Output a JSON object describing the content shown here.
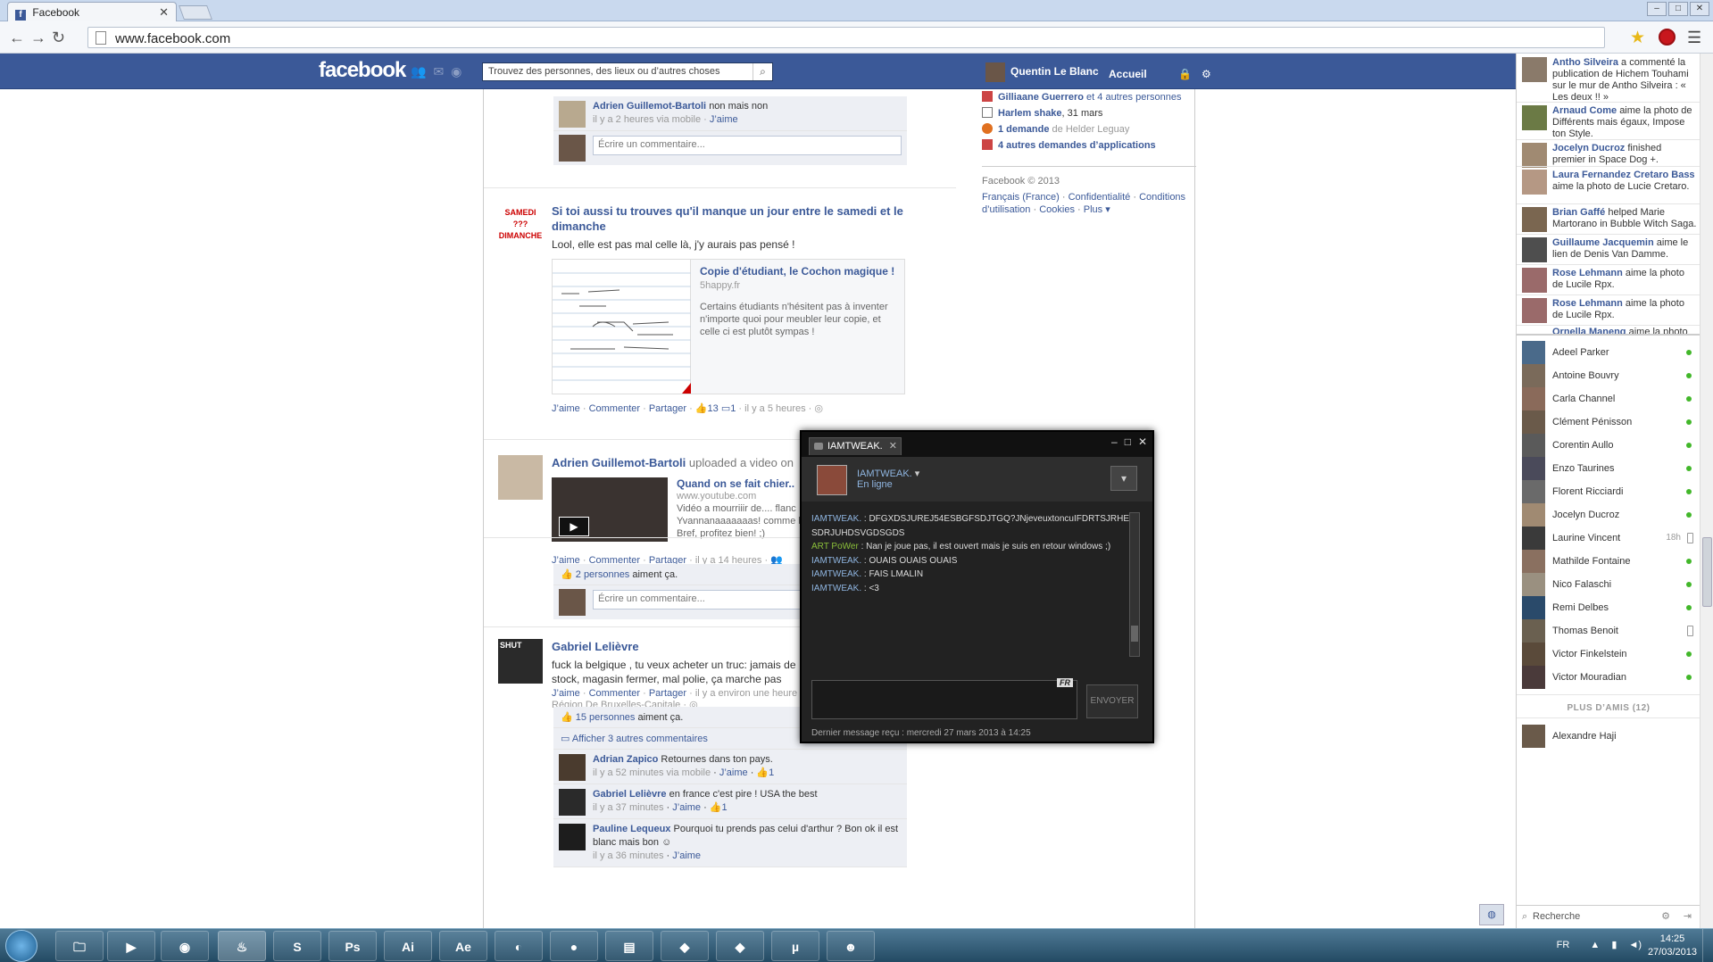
{
  "browser": {
    "tab_title": "Facebook",
    "url": "www.facebook.com"
  },
  "fb": {
    "logo": "facebook",
    "search_placeholder": "Trouvez des personnes, des lieux ou d’autres choses",
    "user_name": "Quentin Le Blanc",
    "home": "Accueil"
  },
  "feed": {
    "top_comment": {
      "author": "Adrien Guillemot-Bartoli",
      "text": "non mais non",
      "meta": "il y a 2 heures via mobile",
      "like": "J’aime"
    },
    "write_comment_placeholder": "Écrire un commentaire...",
    "post1": {
      "avatar_text": "SAMEDI ??? DIMANCHE",
      "title": "Si toi aussi tu trouves qu'il manque un jour entre le samedi et le dimanche",
      "message": "Lool, elle est pas mal celle là, j'y aurais pas pensé !",
      "link_title": "Copie d'étudiant, le Cochon magique !",
      "link_domain": "5happy.fr",
      "link_desc": "Certains étudiants n'hésitent pas à inventer n'importe quoi pour meubler leur copie, et celle ci est plutôt sympas !",
      "actions": {
        "like": "J’aime",
        "comment": "Commenter",
        "share": "Partager",
        "likes": "13",
        "comments": "1",
        "time": "il y a 5 heures"
      }
    },
    "post2": {
      "author": "Adrien Guillemot-Bartoli",
      "verb": "uploaded a video on",
      "link_title": "Quand on se fait chier..",
      "link_domain": "www.youtube.com",
      "link_desc": "Vidéo a mourriiir de.... flanc Yvannanaaaaaaas! comme le Bref, profitez bien! ;)",
      "actions": {
        "like": "J’aime",
        "comment": "Commenter",
        "share": "Partager",
        "time": "il y a 14 heures"
      },
      "likes_link": "2 personnes",
      "likes_suffix": "aiment ça."
    },
    "post3": {
      "author": "Gabriel Lelièvre",
      "avatar_text": "SHUT",
      "message": "fuck la belgique , tu veux acheter un truc: jamais de stock, magasin fermer, mal polie, ça marche pas",
      "actions": {
        "like": "J’aime",
        "comment": "Commenter",
        "share": "Partager",
        "time": "il y a environ une heure"
      },
      "location": "Région De Bruxelles-Capitale",
      "likes_link": "15 personnes",
      "likes_suffix": "aiment ça.",
      "show_comments": "Afficher 3 autres commentaires",
      "comments": [
        {
          "author": "Adrian Zapico",
          "text": "Retournes dans ton pays.",
          "meta": "il y a 52 minutes via mobile",
          "like": "J’aime",
          "count": "1"
        },
        {
          "author": "Gabriel Lelièvre",
          "text": "en france c'est pire ! USA the best",
          "meta": "il y a 37 minutes",
          "like": "J’aime",
          "count": "1"
        },
        {
          "author": "Pauline Lequeux",
          "text": "Pourquoi tu prends pas celui d'arthur ? Bon ok il est blanc mais bon",
          "meta": "il y a 36 minutes",
          "like": "J’aime",
          "count": ""
        }
      ]
    }
  },
  "right_col": {
    "birthday1_name": "Gilliaane Guerrero",
    "birthday1_rest": "et 4 autres personnes",
    "event_name": "Harlem shake",
    "event_date": ", 31 mars",
    "request_bold": "1 demande",
    "request_rest": "de Helder Leguay",
    "app_requests": "4 autres demandes d’applications",
    "copyright": "Facebook © 2013",
    "links": [
      "Français (France)",
      "Confidentialité",
      "Conditions d’utilisation",
      "Cookies",
      "Plus ▾"
    ]
  },
  "ticker": [
    {
      "name": "Antho Silveira",
      "text": "a commenté la publication de Hichem Touhami sur le mur de Antho Silveira : « Les deux !! »"
    },
    {
      "name": "Arnaud Come",
      "text": "aime la photo de Différents mais égaux, Impose ton Style."
    },
    {
      "name": "Jocelyn Ducroz",
      "text": "finished premier in Space Dog +."
    },
    {
      "name": "Laura Fernandez Cretaro Bass",
      "text": "aime la photo de Lucie Cretaro."
    },
    {
      "name": "Brian Gaffé",
      "text": "helped Marie Martorano in Bubble Witch Saga."
    },
    {
      "name": "Guillaume Jacquemin",
      "text": "aime le lien de Denis Van Damme."
    },
    {
      "name": "Rose Lehmann",
      "text": "aime la photo de Lucile Rpx."
    },
    {
      "name": "Rose Lehmann",
      "text": "aime la photo de Lucile Rpx."
    },
    {
      "name": "Ornella Manenq",
      "text": "aime la photo"
    }
  ],
  "buddies": [
    {
      "name": "Adeel Parker",
      "status": "online"
    },
    {
      "name": "Antoine Bouvry",
      "status": "online"
    },
    {
      "name": "Carla Channel",
      "status": "online"
    },
    {
      "name": "Clément Pénisson",
      "status": "online"
    },
    {
      "name": "Corentin Aullo",
      "status": "online"
    },
    {
      "name": "Enzo Taurines",
      "status": "online"
    },
    {
      "name": "Florent Ricciardi",
      "status": "online"
    },
    {
      "name": "Jocelyn Ducroz",
      "status": "online"
    },
    {
      "name": "Laurine Vincent",
      "status": "idle",
      "ago": "18h"
    },
    {
      "name": "Mathilde Fontaine",
      "status": "online"
    },
    {
      "name": "Nico Falaschi",
      "status": "online"
    },
    {
      "name": "Remi Delbes",
      "status": "online"
    },
    {
      "name": "Thomas Benoit",
      "status": "mobile"
    },
    {
      "name": "Victor Finkelstein",
      "status": "online"
    },
    {
      "name": "Victor Mouradian",
      "status": "online"
    }
  ],
  "more_friends": "PLUS D’AMIS (12)",
  "extra_buddy": "Alexandre Haji",
  "ticker_search": "Recherche",
  "chat": {
    "tab_label": "IAMTWEAK.",
    "name": "IAMTWEAK.",
    "status": "En ligne",
    "messages": [
      {
        "who": "IAMTWEAK.",
        "text": ": DFGXDSJUREJ54ESBGFSDJTGQ?JNjeveuxtoncuIFDRTSJRHESDRJUHDSVGDSGDS"
      },
      {
        "who": "ART PoWer",
        "text": ": Nan je joue pas, il est ouvert mais je suis en retour windows ;)"
      },
      {
        "who": "IAMTWEAK.",
        "text": ": OUAIS OUAIS OUAIS"
      },
      {
        "who": "IAMTWEAK.",
        "text": ": FAIS LMALIN"
      },
      {
        "who": "IAMTWEAK.",
        "text": ": <3"
      }
    ],
    "input_lang": "FR",
    "send": "ENVOYER",
    "footer": "Dernier message reçu : mercredi 27 mars 2013 à 14:25"
  },
  "taskbar": {
    "lang": "FR",
    "time": "14:25",
    "date": "27/03/2013",
    "apps": [
      "Explorer",
      "Media",
      "Chrome",
      "Steam",
      "Skype",
      "Photoshop",
      "Illustrator",
      "After Effects",
      "Cinema 4D",
      "Ball",
      "Folder",
      "GPU Tweak",
      "GPU Monitor",
      "uTorrent",
      "Game"
    ]
  },
  "colors": {
    "fb_blue": "#3b5998",
    "online": "#42b72a",
    "chat_bg": "#222222"
  }
}
